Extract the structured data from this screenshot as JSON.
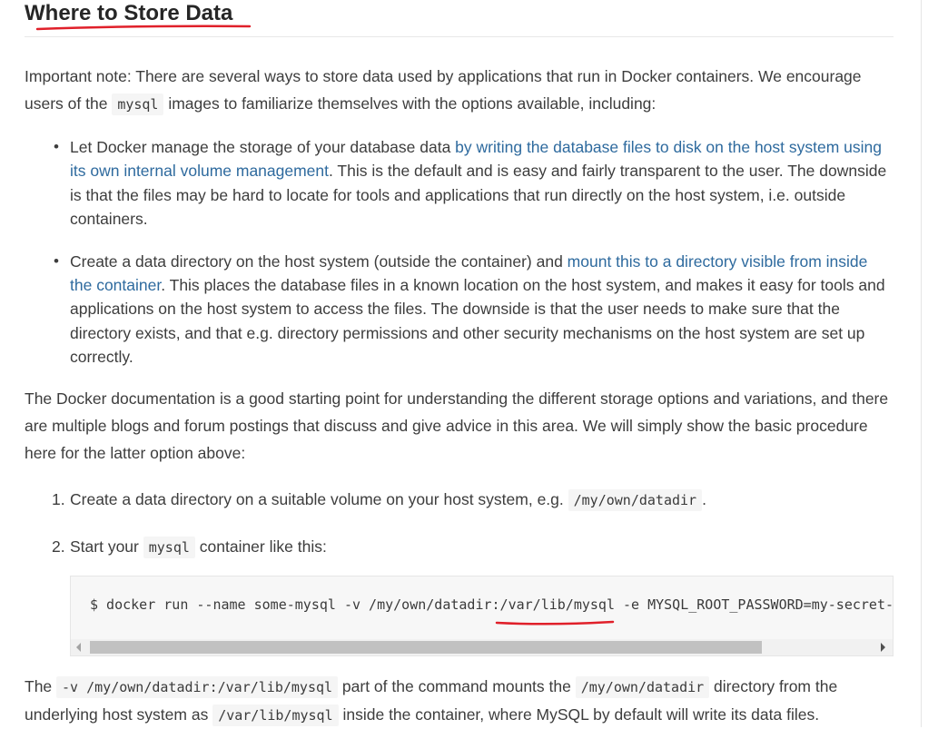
{
  "section": {
    "title": "Where to Store Data"
  },
  "intro": {
    "text_before": "Important note: There are several ways to store data used by applications that run in Docker containers. We encourage users of the ",
    "code": "mysql",
    "text_after": " images to familiarize themselves with the options available, including:"
  },
  "bullets": [
    {
      "text_before": "Let Docker manage the storage of your database data ",
      "link": "by writing the database files to disk on the host system using its own internal volume management",
      "text_after": ". This is the default and is easy and fairly transparent to the user. The downside is that the files may be hard to locate for tools and applications that run directly on the host system, i.e. outside containers."
    },
    {
      "text_before": "Create a data directory on the host system (outside the container) and ",
      "link": "mount this to a directory visible from inside the container",
      "text_after": ". This places the database files in a known location on the host system, and makes it easy for tools and applications on the host system to access the files. The downside is that the user needs to make sure that the directory exists, and that e.g. directory permissions and other security mechanisms on the host system are set up correctly."
    }
  ],
  "docs_paragraph": "The Docker documentation is a good starting point for understanding the different storage options and variations, and there are multiple blogs and forum postings that discuss and give advice in this area. We will simply show the basic procedure here for the latter option above:",
  "steps": [
    {
      "number": "1.",
      "text_before": "Create a data directory on a suitable volume on your host system, e.g. ",
      "code": "/my/own/datadir",
      "text_after": "."
    },
    {
      "number": "2.",
      "text_before": "Start your ",
      "code": "mysql",
      "text_after": " container like this:"
    }
  ],
  "code_block": {
    "command": "$ docker run --name some-mysql -v /my/own/datadir:/var/lib/mysql -e MYSQL_ROOT_PASSWORD=my-secret-pw -d mysql:tag"
  },
  "explanation": {
    "part1": "The ",
    "code1": "-v /my/own/datadir:/var/lib/mysql",
    "part2": " part of the command mounts the ",
    "code2": "/my/own/datadir",
    "part3": " directory from the underlying host system as ",
    "code3": "/var/lib/mysql",
    "part4": " inside the container, where MySQL by default will write its data files."
  },
  "colors": {
    "link": "#2e6a9e",
    "annotation": "#e0202a"
  }
}
